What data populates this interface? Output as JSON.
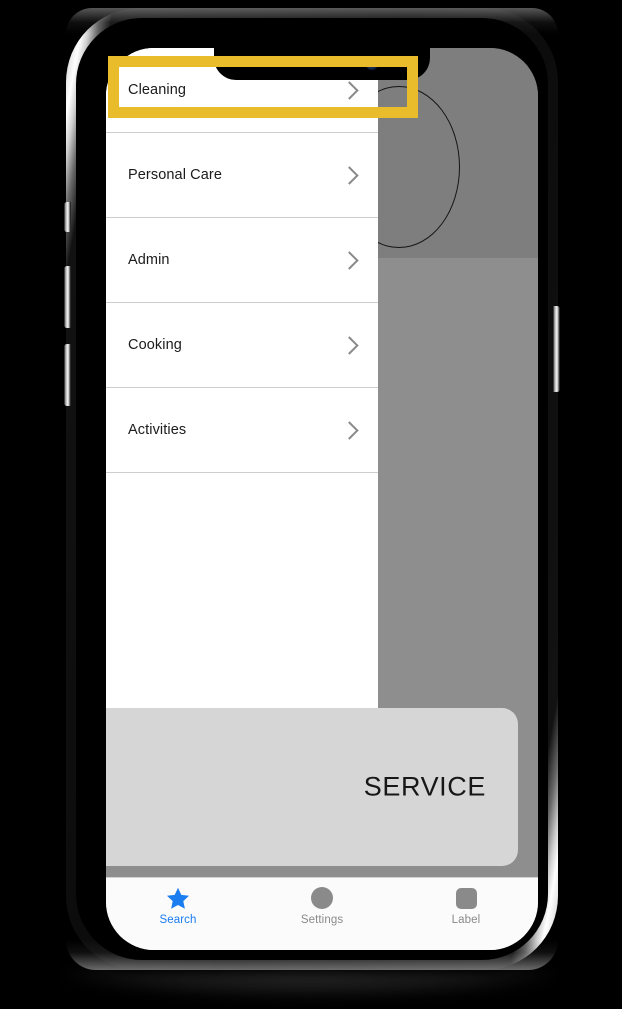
{
  "device": {
    "notch": {
      "speaker_icon": "speaker-slot",
      "camera_icon": "front-camera"
    },
    "buttons": {
      "mute": "mute-switch",
      "volume_up": "volume-up-button",
      "volume_down": "volume-down-button",
      "power": "power-button"
    }
  },
  "menu": {
    "items": [
      {
        "label": "Cleaning",
        "chevron": "chevron-right-icon",
        "highlighted": true
      },
      {
        "label": "Personal Care",
        "chevron": "chevron-right-icon",
        "highlighted": false
      },
      {
        "label": "Admin",
        "chevron": "chevron-right-icon",
        "highlighted": false
      },
      {
        "label": "Cooking",
        "chevron": "chevron-right-icon",
        "highlighted": false
      },
      {
        "label": "Activities",
        "chevron": "chevron-right-icon",
        "highlighted": false
      }
    ]
  },
  "card": {
    "title": "SERVICE"
  },
  "tabs": [
    {
      "label": "Search",
      "icon": "star-icon",
      "active": true
    },
    {
      "label": "Settings",
      "icon": "circle-icon",
      "active": false
    },
    {
      "label": "Label",
      "icon": "square-icon",
      "active": false
    }
  ],
  "colors": {
    "highlight": "#e8bc2a",
    "active_tab": "#1a7df0",
    "inactive_tab": "#8a8a8a",
    "card_background": "#d6d6d6",
    "backdrop_dark": "#7e7e7e",
    "backdrop_light": "#8e8e8e"
  }
}
